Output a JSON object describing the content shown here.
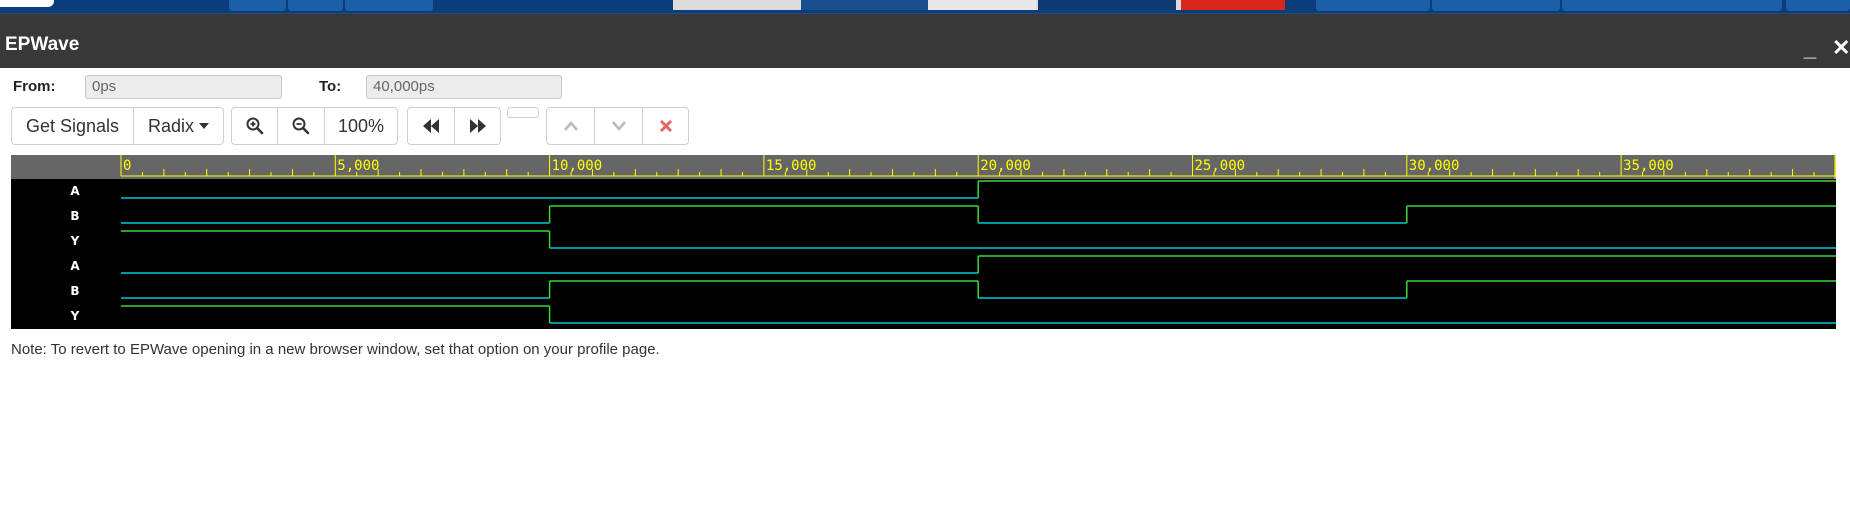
{
  "window": {
    "title": "EPWave"
  },
  "range": {
    "from_label": "From:",
    "from_value": "0ps",
    "to_label": "To:",
    "to_value": "40,000ps"
  },
  "toolbar": {
    "get_signals": "Get Signals",
    "radix": "Radix",
    "zoom_level": "100%"
  },
  "timeline": {
    "tick_labels": [
      "0",
      "5,000",
      "10,000",
      "15,000",
      "20,000",
      "25,000",
      "30,000",
      "35,000"
    ],
    "range_ps": [
      0,
      40000
    ]
  },
  "signals": [
    {
      "name": "A",
      "transitions": [
        [
          0,
          0
        ],
        [
          20000,
          1
        ]
      ]
    },
    {
      "name": "B",
      "transitions": [
        [
          0,
          0
        ],
        [
          10000,
          1
        ],
        [
          20000,
          0
        ],
        [
          30000,
          1
        ]
      ]
    },
    {
      "name": "Y",
      "transitions": [
        [
          0,
          1
        ],
        [
          10000,
          0
        ]
      ]
    },
    {
      "name": "A",
      "transitions": [
        [
          0,
          0
        ],
        [
          20000,
          1
        ]
      ]
    },
    {
      "name": "B",
      "transitions": [
        [
          0,
          0
        ],
        [
          10000,
          1
        ],
        [
          20000,
          0
        ],
        [
          30000,
          1
        ]
      ]
    },
    {
      "name": "Y",
      "transitions": [
        [
          0,
          1
        ],
        [
          10000,
          0
        ]
      ]
    }
  ],
  "note": "Note: To revert to EPWave opening in a new browser window, set that option on your profile page.",
  "colors": {
    "low": "#00c8d8",
    "high": "#3cd43c",
    "ruler_text": "#ffff00",
    "titlebar": "#383838"
  }
}
